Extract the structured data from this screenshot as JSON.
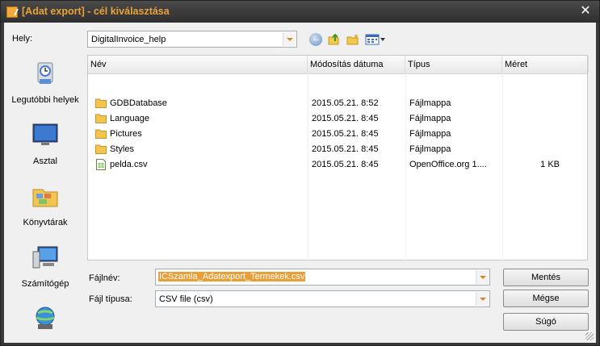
{
  "window": {
    "title": "[Adat export] - cél kiválasztása",
    "close_glyph": "✕",
    "title_color": "#e9a23b"
  },
  "location": {
    "label": "Hely:",
    "value": "DigitalInvoice_help"
  },
  "toolbar": {
    "icons": [
      "back-icon",
      "up-folder-icon",
      "new-folder-icon",
      "view-menu-icon"
    ]
  },
  "places": [
    {
      "label": "Legutóbbi helyek",
      "icon": "recent-places-icon"
    },
    {
      "label": "Asztal",
      "icon": "desktop-icon"
    },
    {
      "label": "Könyvtárak",
      "icon": "libraries-icon"
    },
    {
      "label": "Számítógép",
      "icon": "computer-icon"
    },
    {
      "label": "",
      "icon": "network-icon"
    }
  ],
  "columns": {
    "name": "Név",
    "modified": "Módosítás dátuma",
    "type": "Típus",
    "size": "Méret"
  },
  "files": [
    {
      "name": "GDBDatabase",
      "modified": "2015.05.21. 8:52",
      "type": "Fájlmappa",
      "size": "",
      "icon": "folder-icon"
    },
    {
      "name": "Language",
      "modified": "2015.05.21. 8:45",
      "type": "Fájlmappa",
      "size": "",
      "icon": "folder-icon"
    },
    {
      "name": "Pictures",
      "modified": "2015.05.21. 8:45",
      "type": "Fájlmappa",
      "size": "",
      "icon": "folder-icon"
    },
    {
      "name": "Styles",
      "modified": "2015.05.21. 8:45",
      "type": "Fájlmappa",
      "size": "",
      "icon": "folder-icon"
    },
    {
      "name": "pelda.csv",
      "modified": "2015.05.21. 8:45",
      "type": "OpenOffice.org 1....",
      "size": "1 KB",
      "icon": "spreadsheet-file-icon"
    }
  ],
  "filename": {
    "label": "Fájlnév:",
    "value": "ICSzamla_Adatexport_Termekek.csv"
  },
  "filetype": {
    "label": "Fájl típusa:",
    "value": "CSV file (csv)"
  },
  "buttons": {
    "save": "Mentés",
    "cancel": "Mégse",
    "help": "Súgó"
  }
}
